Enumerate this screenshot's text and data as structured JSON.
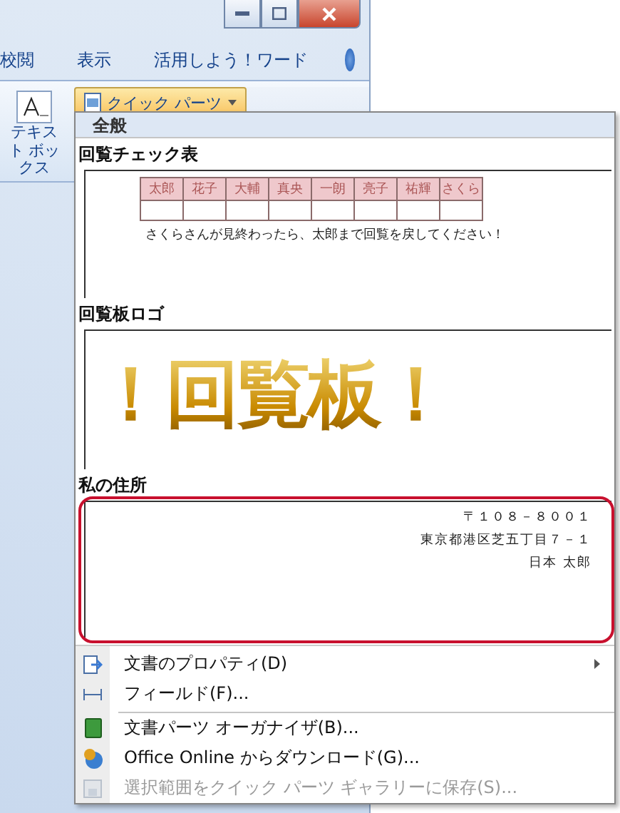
{
  "ribbon": {
    "tabs": [
      {
        "label": "校閲",
        "selected": false
      },
      {
        "label": "表示",
        "selected": false
      },
      {
        "label": "活用しよう！ワード",
        "selected": false
      }
    ],
    "text_box_button": {
      "label": "テキスト ボックス"
    },
    "quick_parts_button": {
      "label": "クイック パーツ",
      "open": true
    }
  },
  "menu": {
    "category": "全般",
    "sections": [
      {
        "kind": "table",
        "title": "回覧チェック表",
        "names": [
          "太郎",
          "花子",
          "大輔",
          "真央",
          "一朗",
          "亮子",
          "祐輝",
          "さくら"
        ],
        "note": "さくらさんが見終わったら、太郎まで回覧を戻してください！"
      },
      {
        "kind": "logo",
        "title": "回覧板ロゴ",
        "text": "！回覧板！"
      },
      {
        "kind": "address",
        "title": "私の住所",
        "lines": [
          "〒１０８－８００１",
          "東京都港区芝五丁目７－１",
          "日本 太郎"
        ],
        "highlighted": true
      }
    ],
    "items": [
      {
        "label": "文書のプロパティ(D)",
        "submenu": true,
        "disabled": false,
        "separator_after": false
      },
      {
        "label": "フィールド(F)...",
        "submenu": false,
        "disabled": false,
        "separator_after": true
      },
      {
        "label": "文書パーツ オーガナイザ(B)...",
        "submenu": false,
        "disabled": false,
        "separator_after": false
      },
      {
        "label": "Office Online からダウンロード(G)...",
        "submenu": false,
        "disabled": false,
        "separator_after": false
      },
      {
        "label": "選択範囲をクイック パーツ ギャラリーに保存(S)...",
        "submenu": false,
        "disabled": true,
        "separator_after": false
      }
    ]
  }
}
